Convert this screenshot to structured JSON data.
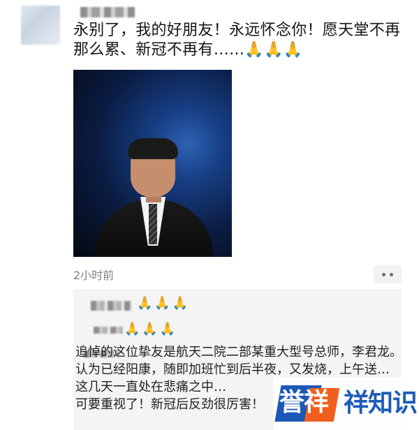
{
  "post": {
    "text": "永别了，我的好朋友！永远怀念你！愿天堂不再那么累、新冠不再有……🙏🙏🙏",
    "time": "2小时前"
  },
  "comment_panel": {
    "reactions_1": "🙏🙏🙏",
    "reactions_2": "🙏🙏🙏",
    "comment_text": "追悼的这位挚友是航天二院二部某重大型号总师，李君龙。认为已经阳康，随即加班忙到后半夜，又发烧，上午送…\n这几天一直处在悲痛之中…\n可要重视了！新冠后反劲很厉害！"
  },
  "brand": {
    "logo_text": "誉祥",
    "name": "祥知识"
  }
}
